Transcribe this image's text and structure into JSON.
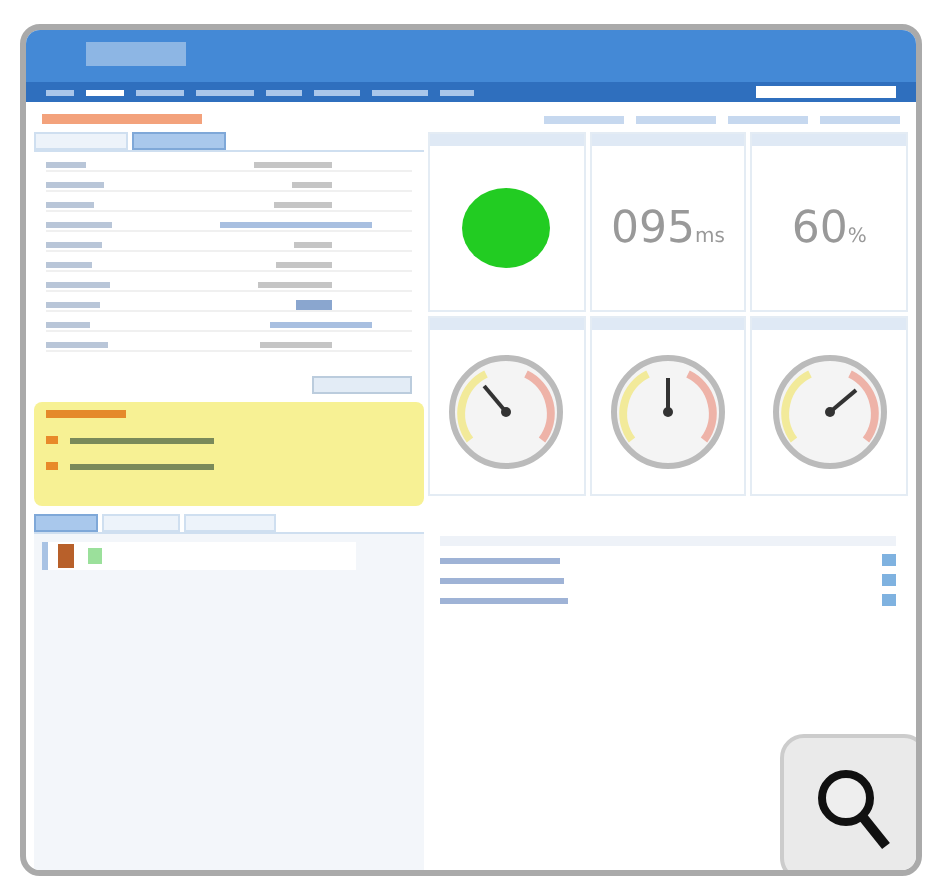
{
  "nav": [
    {
      "selected": false
    },
    {
      "selected": true
    },
    {
      "selected": false
    },
    {
      "selected": false
    },
    {
      "selected": false
    },
    {
      "selected": false
    },
    {
      "selected": false
    },
    {
      "selected": false
    }
  ],
  "details": {
    "tabs": [
      {
        "selected": false
      },
      {
        "selected": true
      }
    ],
    "rows": [
      {
        "kind": "text"
      },
      {
        "kind": "text"
      },
      {
        "kind": "text"
      },
      {
        "kind": "link"
      },
      {
        "kind": "text"
      },
      {
        "kind": "text"
      },
      {
        "kind": "text"
      },
      {
        "kind": "badge"
      },
      {
        "kind": "link"
      },
      {
        "kind": "text"
      }
    ]
  },
  "alerts": [
    {
      "kind": "warning"
    },
    {
      "kind": "warning"
    }
  ],
  "bottom_tabs": [
    {
      "selected": true
    },
    {
      "selected": false
    },
    {
      "selected": false
    }
  ],
  "widgets": [
    {
      "kind": "status",
      "color": "#22cc22"
    },
    {
      "kind": "metric",
      "value": "095",
      "unit": "ms"
    },
    {
      "kind": "metric",
      "value": "60",
      "unit": "%"
    },
    {
      "kind": "gauge"
    },
    {
      "kind": "gauge"
    },
    {
      "kind": "gauge"
    }
  ],
  "table": {
    "rows": [
      {
        "kind": "row"
      },
      {
        "kind": "row"
      },
      {
        "kind": "row"
      }
    ]
  }
}
